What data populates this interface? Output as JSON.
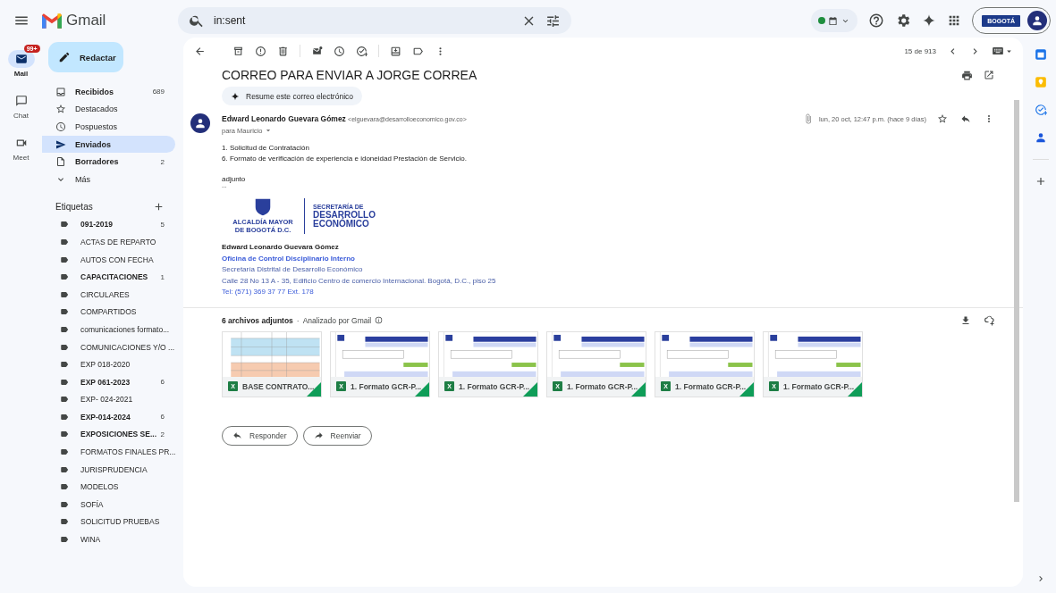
{
  "header": {
    "app_name": "Gmail",
    "search": {
      "value": "in:sent"
    },
    "status": {
      "color": "#1e8e3e"
    },
    "account_logo_text": "BOGOTÁ"
  },
  "rail": [
    {
      "label": "Mail",
      "badge": "99+",
      "selected": true
    },
    {
      "label": "Chat",
      "selected": false
    },
    {
      "label": "Meet",
      "selected": false
    }
  ],
  "compose": {
    "label": "Redactar"
  },
  "folders": [
    {
      "label": "Recibidos",
      "count": "689",
      "selected": false,
      "unread": true
    },
    {
      "label": "Destacados",
      "selected": false,
      "unread": false
    },
    {
      "label": "Pospuestos",
      "selected": false,
      "unread": false
    },
    {
      "label": "Enviados",
      "selected": true,
      "unread": true
    },
    {
      "label": "Borradores",
      "count": "2",
      "selected": false,
      "unread": true
    },
    {
      "label": "Más",
      "selected": false,
      "unread": false
    }
  ],
  "labels": {
    "title": "Etiquetas",
    "items": [
      {
        "label": "091-2019",
        "count": "5",
        "unread": true
      },
      {
        "label": "ACTAS DE REPARTO",
        "unread": false
      },
      {
        "label": "AUTOS CON FECHA",
        "unread": false
      },
      {
        "label": "CAPACITACIONES",
        "count": "1",
        "unread": true
      },
      {
        "label": "CIRCULARES",
        "unread": false
      },
      {
        "label": "COMPARTIDOS",
        "unread": false
      },
      {
        "label": "comunicaciones formato...",
        "unread": false
      },
      {
        "label": "COMUNICACIONES Y/O ...",
        "unread": false
      },
      {
        "label": "EXP 018-2020",
        "unread": false
      },
      {
        "label": "EXP 061-2023",
        "count": "6",
        "unread": true
      },
      {
        "label": "EXP- 024-2021",
        "unread": false
      },
      {
        "label": "EXP-014-2024",
        "count": "6",
        "unread": true
      },
      {
        "label": "EXPOSICIONES SE...",
        "count": "2",
        "unread": true
      },
      {
        "label": "FORMATOS FINALES PR...",
        "unread": false
      },
      {
        "label": "JURISPRUDENCIA",
        "unread": false
      },
      {
        "label": "MODELOS",
        "unread": false
      },
      {
        "label": "SOFÍA",
        "unread": false
      },
      {
        "label": "SOLICITUD PRUEBAS",
        "unread": false
      },
      {
        "label": "WINA",
        "unread": false
      }
    ]
  },
  "toolbar": {
    "counter": "15 de 913"
  },
  "message": {
    "subject": "CORREO PARA ENVIAR A JORGE CORREA",
    "summarize": "Resume este correo electrónico",
    "sender": "Edward Leonardo Guevara Gómez",
    "email": "<elguevara@desarrolloeconomico.gov.co>",
    "recipient": "para Mauricio",
    "date": "lun, 20 oct, 12:47 p.m. (hace 9 días)",
    "starred": false,
    "body": [
      "1. Solicitud de Contratación",
      "6. Formato de verificación de experiencia e idoneidad Prestación de Servicio."
    ],
    "closing": "adjunto",
    "separator": "--",
    "logo": {
      "seal_text": "ALCALDÍA MAYOR DE BOGOTÁ D.C.",
      "title_small": "SECRETARÍA DE",
      "title_1": "DESARROLLO",
      "title_2": "ECONÓMICO"
    },
    "signature": [
      {
        "kind": "name",
        "text": "Edward Leonardo Guevara Gómez"
      },
      {
        "kind": "department",
        "text": "Oficina de Control Disciplinario Interno"
      },
      {
        "kind": "text",
        "text": "Secretaría Distrital de Desarrollo Económico"
      },
      {
        "kind": "text",
        "text": "Calle 28 No 13 A - 35, Edificio Centro de comercio Internacional. Bogotá, D.C., piso 25"
      },
      {
        "kind": "link",
        "text": "Tel: (571) 369 37 77 Ext. 178"
      }
    ],
    "attachments_count": "6 archivos adjuntos",
    "dot": "·",
    "scanned": "Analizado por Gmail",
    "attachments": [
      {
        "name": "BASE CONTRATO...",
        "kind": "table",
        "badge": "X"
      },
      {
        "name": "1. Formato GCR-P...",
        "kind": "form",
        "badge": "X"
      },
      {
        "name": "1. Formato GCR-P...",
        "kind": "form",
        "badge": "X"
      },
      {
        "name": "1. Formato GCR-P...",
        "kind": "form",
        "badge": "X"
      },
      {
        "name": "1. Formato GCR-P...",
        "kind": "form",
        "badge": "X"
      },
      {
        "name": "1. Formato GCR-P...",
        "kind": "form",
        "badge": "X"
      }
    ],
    "actions": [
      {
        "label": "Responder"
      },
      {
        "label": "Reenviar"
      }
    ]
  }
}
